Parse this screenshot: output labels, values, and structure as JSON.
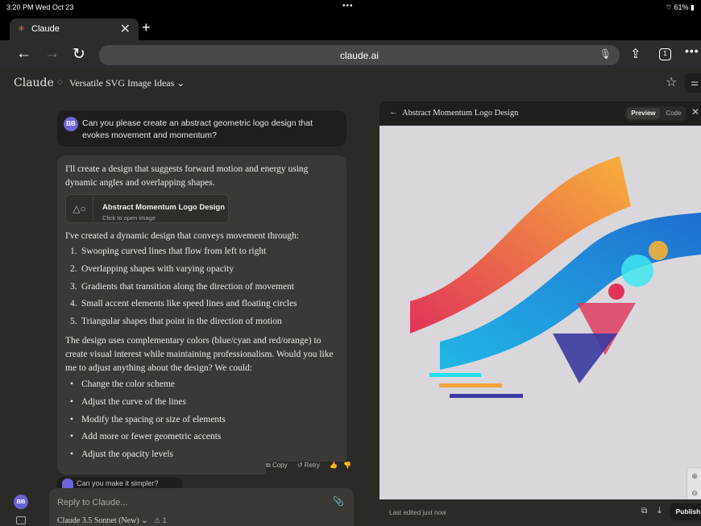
{
  "status": {
    "time": "3:20 PM  Wed Oct 23",
    "dots": "•••",
    "battery": "61%"
  },
  "browser": {
    "tab_title": "Claude",
    "tab_close": "✕",
    "new_tab": "+",
    "url": "claude.ai",
    "tab_count": "1",
    "more": "•••"
  },
  "app": {
    "logo": "Claude",
    "chat_title": "Versatile SVG Image Ideas ⌄"
  },
  "user_message": {
    "avatar": "BB",
    "text": "Can you please create an abstract geometric logo design that evokes movement and momentum?"
  },
  "reply": {
    "intro": "I'll create a design that suggests forward motion and energy using dynamic angles and overlapping shapes.",
    "artifact_title": "Abstract Momentum Logo Design",
    "artifact_sub": "Click to open image",
    "lead": "I've created a dynamic design that conveys movement through:",
    "points": [
      "Swooping curved lines that flow from left to right",
      "Overlapping shapes with varying opacity",
      "Gradients that transition along the direction of movement",
      "Small accent elements like speed lines and floating circles",
      "Triangular shapes that point in the direction of motion"
    ],
    "summary": "The design uses complementary colors (blue/cyan and red/orange) to create visual interest while maintaining professionalism. Would you like me to adjust anything about the design? We could:",
    "options": [
      "Change the color scheme",
      "Adjust the curve of the lines",
      "Modify the spacing or size of elements",
      "Add more or fewer geometric accents",
      "Adjust the opacity levels"
    ],
    "copy_label": "Copy",
    "retry_label": "Retry"
  },
  "next_message": {
    "text": "Can you make it simpler?"
  },
  "composer": {
    "placeholder": "Reply to Claude...",
    "model": "Claude 3.5 Sonnet (New) ⌄",
    "attachments": "1"
  },
  "sidebar": {
    "avatar": "BB"
  },
  "artifact_panel": {
    "title": "Abstract Momentum Logo Design",
    "preview_label": "Preview",
    "code_label": "Code",
    "last_edited": "Last edited just now",
    "publish_label": "Publish"
  },
  "colors": {
    "accent": "#d97757",
    "avatar": "#6b64d6",
    "orange": "#f5a33b",
    "red": "#e0335a",
    "blue": "#1f7ed0",
    "cyan": "#22d3ee",
    "indigo": "#3b3aa0"
  }
}
